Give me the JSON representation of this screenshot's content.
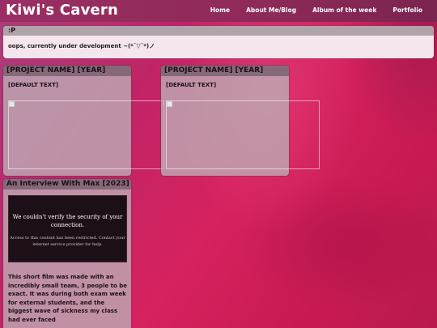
{
  "site": {
    "title": "Kiwi's Cavern"
  },
  "nav": [
    {
      "label": "Home"
    },
    {
      "label": "About Me/Blog"
    },
    {
      "label": "Album of the week"
    },
    {
      "label": "Portfolio"
    }
  ],
  "notice": {
    "title": ":P",
    "message": "oops, currently under development ~(*¯▽¯*)ノ"
  },
  "projects": [
    {
      "title": "[PROJECT NAME] [YEAR]",
      "text": "[DEFAULT TEXT]"
    },
    {
      "title": "[PROJECT NAME] [YEAR]",
      "text": "[DEFAULT TEXT]"
    }
  ],
  "interview": {
    "title": "An Interview With Max [2023]",
    "video_heading": "We couldn't verify the security of your connection.",
    "video_subtext": "Access to this content has been restricted. Contact your internet service provider for help.",
    "description": "This short film was made with an incredibly small team, 3 people to be exact. It was during both exam week for external students, and the biggest wave of sickness my class had ever faced"
  }
}
